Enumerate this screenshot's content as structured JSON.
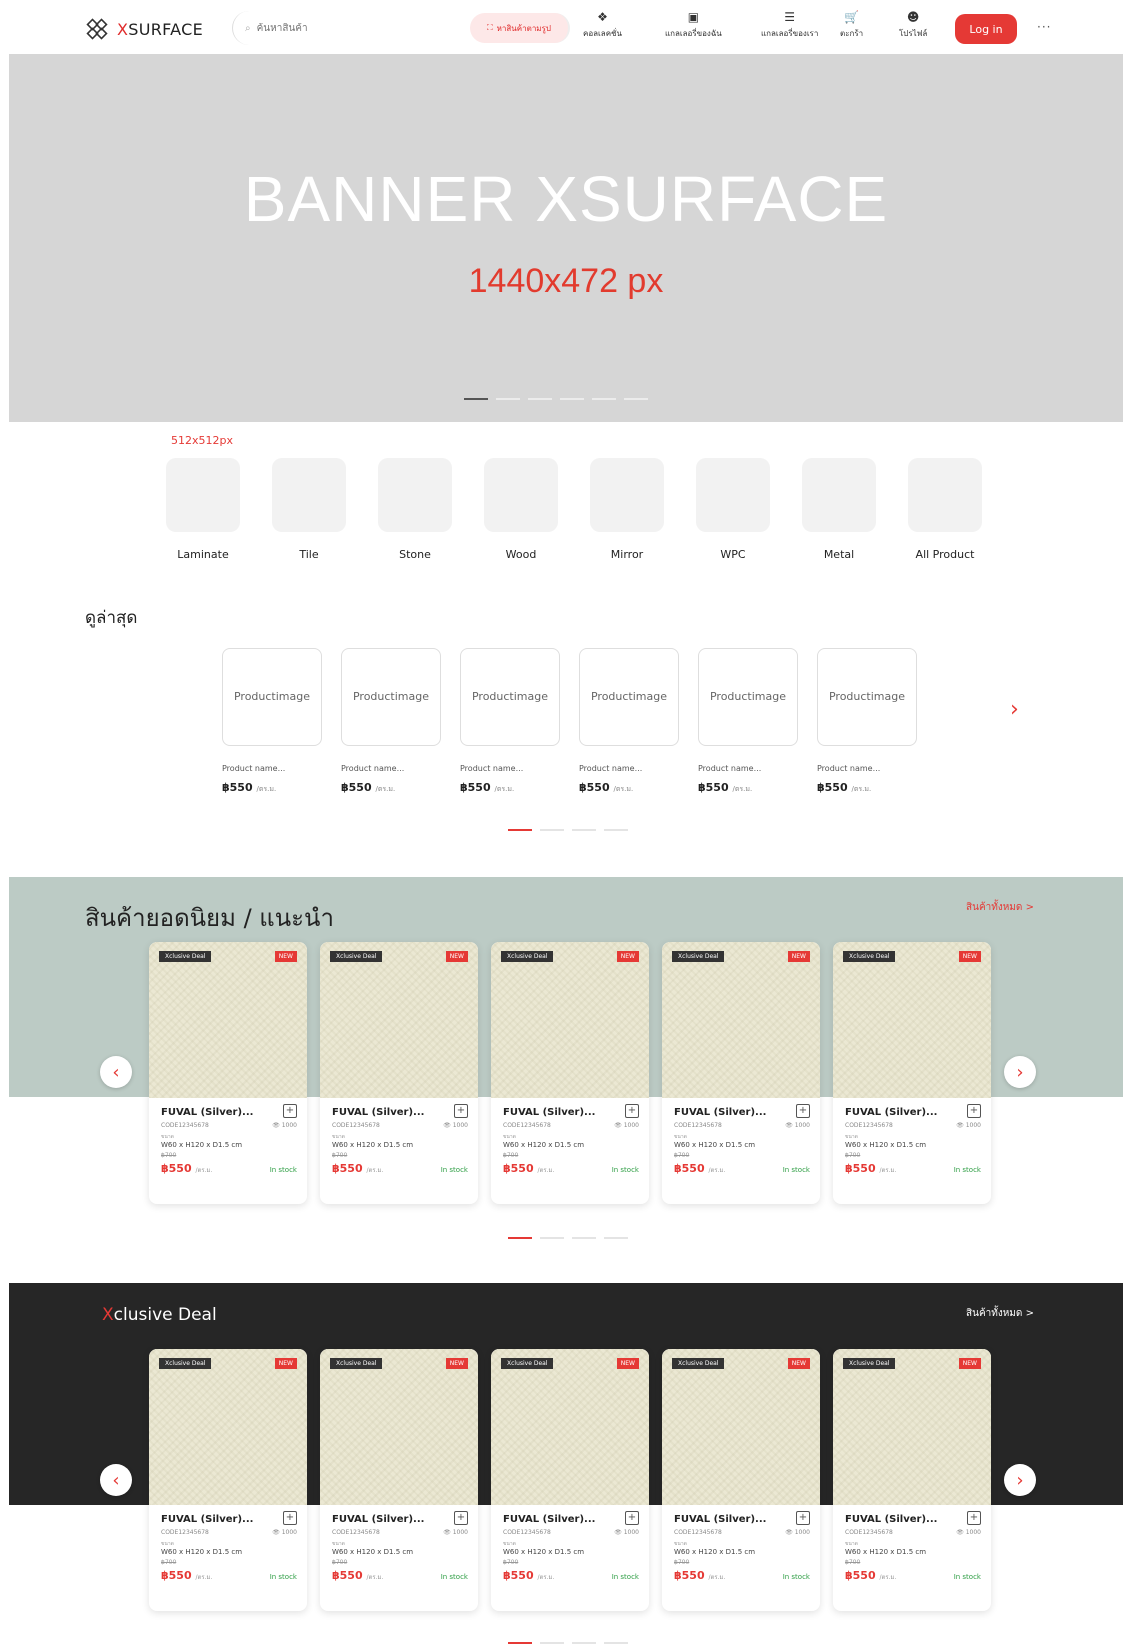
{
  "header": {
    "logo_prefix": "X",
    "logo_rest": "SURFACE",
    "search_placeholder": "ค้นหาสินค้า",
    "pill_label": "หาสินค้าตามรูป",
    "nav": [
      {
        "icon": "catalog-icon",
        "glyph": "❖",
        "label": "คอลเลคชั่น"
      },
      {
        "icon": "save-icon",
        "glyph": "▣",
        "label": "แกลเลอรี่ของฉัน"
      },
      {
        "icon": "list-icon",
        "glyph": "☰",
        "label": "แกลเลอรี่ของเรา"
      },
      {
        "icon": "cart-icon",
        "glyph": "🛒",
        "label": "ตะกร้า"
      },
      {
        "icon": "user-icon",
        "glyph": "☻",
        "label": "โปรไฟล์"
      }
    ],
    "login_label": "Log in",
    "more_label": "···"
  },
  "banner": {
    "title": "BANNER XSURFACE",
    "subtitle": "1440x472 px",
    "slide_count": 6,
    "active_slide": 0
  },
  "categories": {
    "note": "512x512px",
    "items": [
      "Laminate",
      "Tile",
      "Stone",
      "Wood",
      "Mirror",
      "WPC",
      "Metal",
      "All Product"
    ]
  },
  "recent": {
    "title": "ดูล่าสุด",
    "image_placeholder_line1": "Product",
    "image_placeholder_line2": "image",
    "items": [
      {
        "name": "Product name...",
        "price": "฿550",
        "unit": "/ตร.ม."
      },
      {
        "name": "Product name...",
        "price": "฿550",
        "unit": "/ตร.ม."
      },
      {
        "name": "Product name...",
        "price": "฿550",
        "unit": "/ตร.ม."
      },
      {
        "name": "Product name...",
        "price": "฿550",
        "unit": "/ตร.ม."
      },
      {
        "name": "Product name...",
        "price": "฿550",
        "unit": "/ตร.ม."
      },
      {
        "name": "Product name...",
        "price": "฿550",
        "unit": "/ตร.ม."
      }
    ],
    "page_count": 4,
    "active_page": 0
  },
  "popular": {
    "title": "สินค้ายอดนิยม / แนะนำ",
    "see_all": "สินค้าทั้งหมด  >",
    "page_count": 4,
    "active_page": 0
  },
  "xclusive": {
    "title_prefix": "X",
    "title_rest": "clusive Deal",
    "see_all": "สินค้าทั้งหมด  >",
    "page_count": 4,
    "active_page": 0
  },
  "product_card": {
    "deal_tag": "Xclusive Deal",
    "new_tag": "NEW",
    "name": "FUVAL (Silver)...",
    "code": "CODE12345678",
    "views": "👁 1000",
    "dim_label": "ขนาด",
    "dimensions": "W60 x H120 x D1.5 cm",
    "old_price": "฿700",
    "price": "฿550",
    "unit": "/ตร.ม.",
    "stock": "In stock"
  },
  "colors": {
    "accent": "#e53935",
    "popular_bg": "#bccbc5",
    "xclusive_bg": "#262626",
    "banner_bg": "#d6d6d6"
  }
}
